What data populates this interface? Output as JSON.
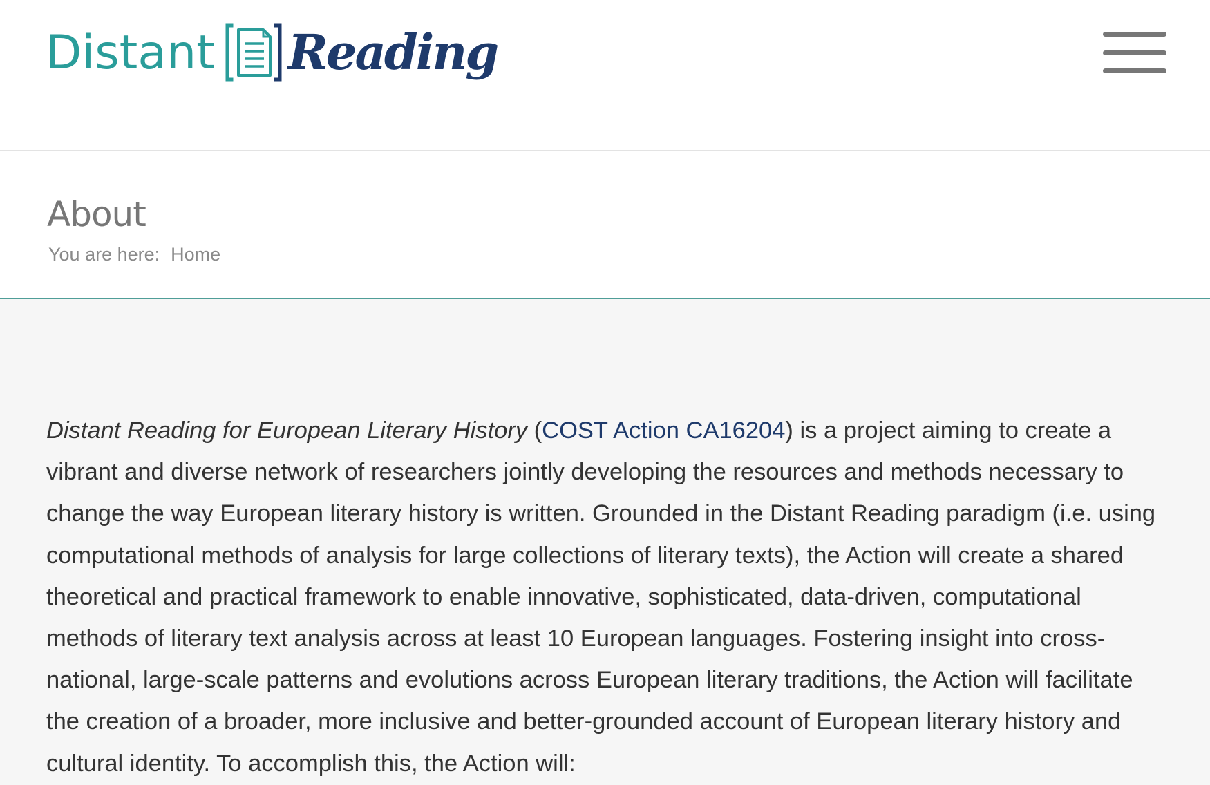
{
  "header": {
    "logo": {
      "word1": "Distant",
      "word2": "Reading",
      "icon": "document-bracket-icon"
    },
    "menu_icon": "hamburger-menu-icon"
  },
  "title_bar": {
    "title": "About",
    "breadcrumb": {
      "label": "You are here:",
      "items": [
        "Home"
      ]
    }
  },
  "content": {
    "paragraph": {
      "italic_title": "Distant Reading for European Literary History",
      "open_paren": " (",
      "link_text": "COST Action CA16204",
      "body": ") is a project aiming to create a vibrant and diverse network of researchers jointly developing the resources and methods necessary to change the way European literary history is written. Grounded in the Distant Reading paradigm (i.e. using computational methods of analysis for large collections of literary texts), the Action will create a shared theoretical and practical framework to enable innovative, sophisticated, data-driven, computational methods of literary text analysis across at least 10 European languages. Fostering insight into cross-national, large-scale patterns and evolutions across European literary traditions, the Action will facilitate the creation of a broader, more inclusive and better-grounded account of European literary history and cultural identity. To accomplish this, the Action will:"
    }
  },
  "colors": {
    "teal": "#2a9d9a",
    "navy": "#1e3a6b",
    "divider_teal": "#4f9e98",
    "content_bg": "#f6f6f6"
  }
}
